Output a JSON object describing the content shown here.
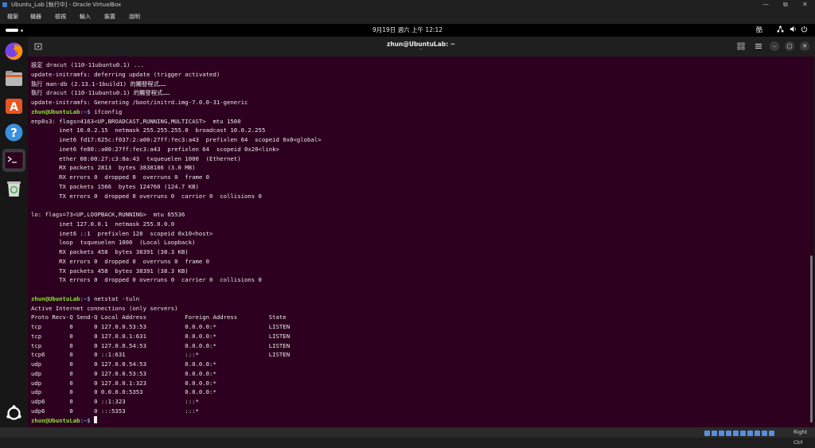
{
  "window": {
    "title": "Ubuntu_Lab [執行中] - Oracle VirtualBox",
    "controls": [
      "—",
      "⧉",
      "✕"
    ]
  },
  "menu": {
    "items": [
      "檔案",
      "機器",
      "檢視",
      "輸入",
      "裝置",
      "說明"
    ]
  },
  "gnome": {
    "clock": "9月19日 週六 上午 12:12",
    "tray": {
      "input_method": "酷"
    }
  },
  "dock": {
    "items": [
      {
        "name": "firefox",
        "color": "#e66000"
      },
      {
        "name": "files",
        "color": "#a0a0a0"
      },
      {
        "name": "app-center",
        "color": "#e95420"
      },
      {
        "name": "help",
        "color": "#3c8fdc"
      },
      {
        "name": "terminal",
        "color": "#2c001e"
      },
      {
        "name": "trash",
        "color": "#d9d9d9"
      }
    ]
  },
  "terminal": {
    "title": "zhun@UbuntuLab: ~",
    "subtitle": "~",
    "prompt_user": "zhun@UbuntuLab",
    "prompt_path": ":~$ ",
    "lines": [
      {
        "text": "設定 dracut (110-11ubuntu0.1) ..."
      },
      {
        "text": "update-initramfs: deferring update (trigger activated)"
      },
      {
        "text": "執行 man-db (2.13.1-1build1) 的觸發程式……"
      },
      {
        "text": "執行 dracut (110-11ubuntu0.1) 的觸發程式……"
      },
      {
        "text": "update-initramfs: Generating /boot/initrd.img-7.0.0-31-generic"
      },
      {
        "prompt": true,
        "text": "ifconfig"
      },
      {
        "text": "enp0s3: flags=4163<UP,BROADCAST,RUNNING,MULTICAST>  mtu 1500"
      },
      {
        "text": "        inet 10.0.2.15  netmask 255.255.255.0  broadcast 10.0.2.255"
      },
      {
        "text": "        inet6 fd17:625c:f037:2:a00:27ff:fec3:a43  prefixlen 64  scopeid 0x0<global>"
      },
      {
        "text": "        inet6 fe80::a00:27ff:fec3:a43  prefixlen 64  scopeid 0x20<link>"
      },
      {
        "text": "        ether 08:00:27:c3:0a:43  txqueuelen 1000  (Ethernet)"
      },
      {
        "text": "        RX packets 2813  bytes 3838186 (3.0 MB)"
      },
      {
        "text": "        RX errors 0  dropped 0  overruns 0  frame 0"
      },
      {
        "text": "        TX packets 1566  bytes 124760 (124.7 KB)"
      },
      {
        "text": "        TX errors 0  dropped 0 overruns 0  carrier 0  collisions 0"
      },
      {
        "text": ""
      },
      {
        "text": "lo: flags=73<UP,LOOPBACK,RUNNING>  mtu 65536"
      },
      {
        "text": "        inet 127.0.0.1  netmask 255.0.0.0"
      },
      {
        "text": "        inet6 ::1  prefixlen 128  scopeid 0x10<host>"
      },
      {
        "text": "        loop  txqueuelen 1000  (Local Loopback)"
      },
      {
        "text": "        RX packets 458  bytes 38391 (38.3 KB)"
      },
      {
        "text": "        RX errors 0  dropped 0  overruns 0  frame 0"
      },
      {
        "text": "        TX packets 458  bytes 38391 (38.3 KB)"
      },
      {
        "text": "        TX errors 0  dropped 0 overruns 0  carrier 0  collisions 0"
      },
      {
        "text": ""
      },
      {
        "prompt": true,
        "text": "netstat -tuln"
      },
      {
        "text": "Active Internet connections (only servers)"
      },
      {
        "text": "Proto Recv-Q Send-Q Local Address           Foreign Address         State"
      },
      {
        "text": "tcp        0      0 127.0.0.53:53           0.0.0.0:*               LISTEN"
      },
      {
        "text": "tcp        0      0 127.0.0.1:631           0.0.0.0:*               LISTEN"
      },
      {
        "text": "tcp        0      0 127.0.0.54:53           0.0.0.0:*               LISTEN"
      },
      {
        "text": "tcp6       0      0 ::1:631                 :::*                    LISTEN"
      },
      {
        "text": "udp        0      0 127.0.0.54:53           0.0.0.0:*"
      },
      {
        "text": "udp        0      0 127.0.0.53:53           0.0.0.0:*"
      },
      {
        "text": "udp        0      0 127.0.0.1:323           0.0.0.0:*"
      },
      {
        "text": "udp        0      0 0.0.0.0:5353            0.0.0.0:*"
      },
      {
        "text": "udp6       0      0 ::1:323                 :::*"
      },
      {
        "text": "udp6       0      0 :::5353                 :::*"
      },
      {
        "prompt": true,
        "text": "",
        "cursor": true
      }
    ]
  },
  "statusbar": {
    "host_key": "Right Ctrl"
  },
  "colors": {
    "terminal_bg": "#2c001e",
    "prompt_user": "#8ae234",
    "prompt_path": "#729fcf"
  }
}
